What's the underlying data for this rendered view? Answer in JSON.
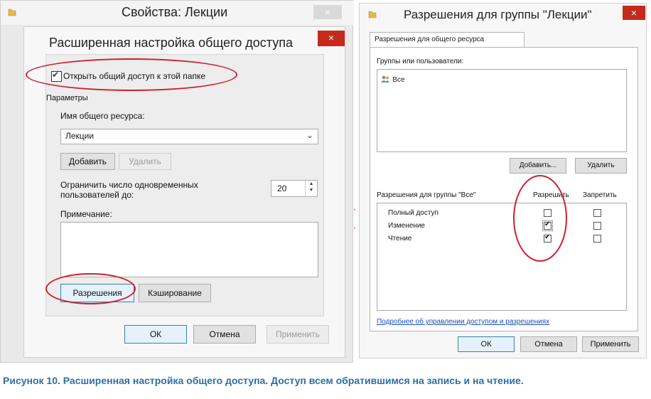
{
  "outer_window": {
    "title": "Свойства: Лекции",
    "close": "×"
  },
  "advanced_dialog": {
    "title": "Расширенная настройка общего доступа",
    "close": "×",
    "share_checkbox_label": "Открыть общий доступ к этой папке",
    "share_checked": true,
    "params_group": "Параметры",
    "share_name_label": "Имя общего ресурса:",
    "share_name_value": "Лекции",
    "add_button": "Добавить",
    "remove_button": "Удалить",
    "limit_label_line1": "Ограничить число одновременных",
    "limit_label_line2": "пользователей до:",
    "limit_value": "20",
    "comment_label": "Примечание:",
    "permissions_button": "Разрешения",
    "caching_button": "Кэширование",
    "ok_button": "ОК",
    "cancel_button": "Отмена",
    "apply_button": "Применить"
  },
  "permissions_dialog": {
    "title": "Разрешения для группы \"Лекции\"",
    "close": "×",
    "tab": "Разрешения для общего ресурса",
    "groups_label": "Группы или пользователи:",
    "groups": [
      {
        "name": "Все",
        "icon": "users-icon"
      }
    ],
    "add_button": "Добавить...",
    "remove_button": "Удалить",
    "perm_for_label": "Разрешения для группы \"Все\"",
    "allow_header": "Разрешить",
    "deny_header": "Запретить",
    "permissions": [
      {
        "name": "Полный доступ",
        "allow": false,
        "deny": false
      },
      {
        "name": "Изменение",
        "allow": true,
        "deny": false
      },
      {
        "name": "Чтение",
        "allow": true,
        "deny": false
      }
    ],
    "help_link": "Подробнее об управлении доступом и разрешениях",
    "ok_button": "ОК",
    "cancel_button": "Отмена",
    "apply_button": "Применить"
  },
  "caption": "Рисунок 10. Расширенная настройка общего доступа. Доступ всем обратившимся на запись и на чтение.",
  "colors": {
    "annotation": "#cc1f2f",
    "caption": "#2e6fa6",
    "close_button": "#c42b1c"
  }
}
